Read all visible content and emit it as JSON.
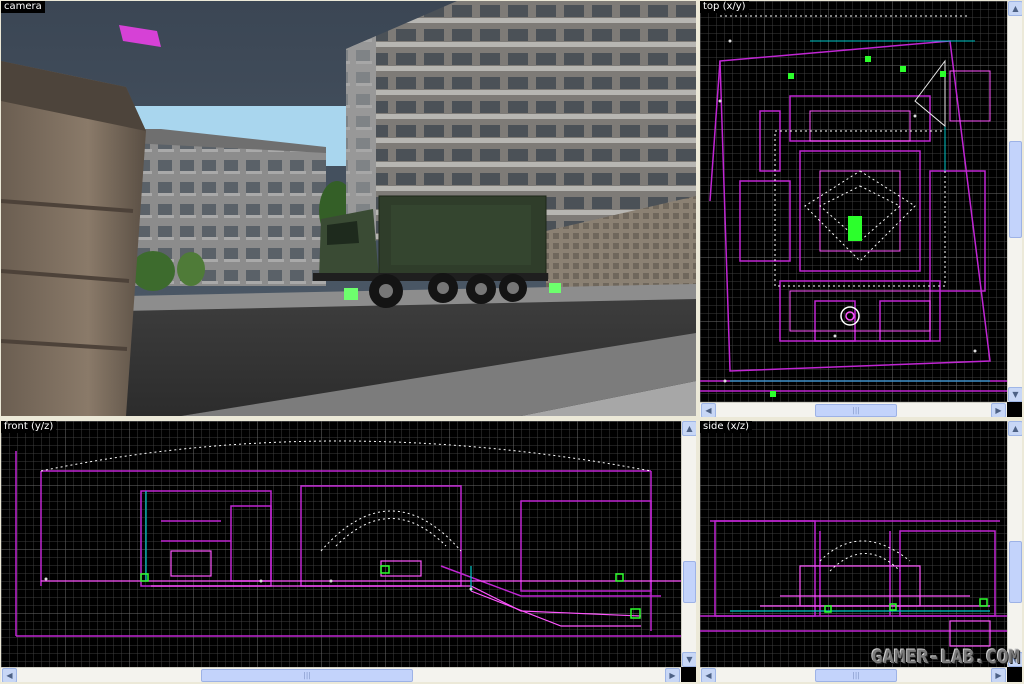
{
  "viewports": {
    "camera": {
      "label": "camera"
    },
    "top": {
      "label": "top (x/y)"
    },
    "front": {
      "label": "front (y/z)"
    },
    "side": {
      "label": "side (x/z)"
    }
  },
  "scroll_glyphs": {
    "up": "▲",
    "down": "▼",
    "left": "◀",
    "right": "▶",
    "grip": "|||"
  },
  "watermark": "GAMER-LAB.COM",
  "colors": {
    "grid_minor": "#4a4a4a",
    "grid_major": "#777777",
    "brush": "#c026d3",
    "brush_bright": "#ff55ff",
    "entity_point": "#ffffff",
    "entity_green": "#2cff2c",
    "path": "#00c8c8",
    "label_bg": "#000000",
    "label_text": "#ffffff",
    "scrollbar_bg": "#f4f3ee",
    "scroll_thumb": "#c3d3fb"
  }
}
